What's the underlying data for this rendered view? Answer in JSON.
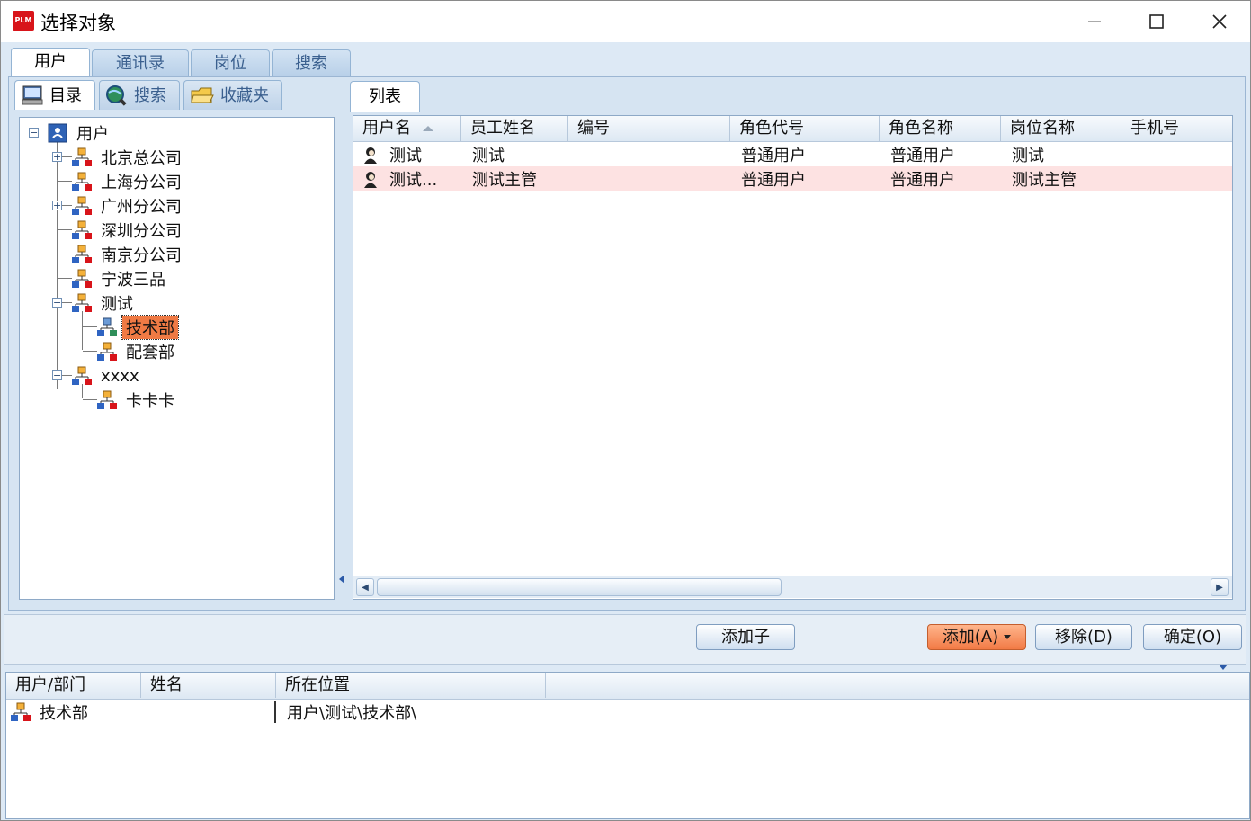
{
  "window": {
    "title": "选择对象",
    "logo_text": "PLM",
    "controls": [
      "minimize",
      "maximize",
      "close"
    ]
  },
  "main_tabs": [
    {
      "label": "用户",
      "active": true
    },
    {
      "label": "通讯录",
      "active": false
    },
    {
      "label": "岗位",
      "active": false
    },
    {
      "label": "搜索",
      "active": false
    }
  ],
  "sub_tabs": [
    {
      "label": "目录",
      "icon": "computer-icon",
      "active": true
    },
    {
      "label": "搜索",
      "icon": "globe-search-icon",
      "active": false
    },
    {
      "label": "收藏夹",
      "icon": "folder-favorites-icon",
      "active": false
    }
  ],
  "tree": {
    "root": "用户",
    "nodes": [
      {
        "label": "北京总公司",
        "expander": "+"
      },
      {
        "label": "上海分公司",
        "expander": ""
      },
      {
        "label": "广州分公司",
        "expander": "+"
      },
      {
        "label": "深圳分公司",
        "expander": ""
      },
      {
        "label": "南京分公司",
        "expander": ""
      },
      {
        "label": "宁波三品",
        "expander": ""
      },
      {
        "label": "测试",
        "expander": "−"
      },
      {
        "label": "技术部",
        "expander": "",
        "selected": true
      },
      {
        "label": "配套部",
        "expander": ""
      },
      {
        "label": "xxxx",
        "expander": "−"
      },
      {
        "label": "卡卡卡",
        "expander": ""
      }
    ]
  },
  "list": {
    "tab_label": "列表",
    "columns": [
      "用户名",
      "员工姓名",
      "编号",
      "角色代号",
      "角色名称",
      "岗位名称",
      "手机号"
    ],
    "rows": [
      [
        "测试",
        "测试",
        "",
        "普通用户",
        "普通用户",
        "测试",
        ""
      ],
      [
        "测试...",
        "测试主管",
        "",
        "普通用户",
        "普通用户",
        "测试主管",
        ""
      ]
    ]
  },
  "actions": {
    "add_child": "添加子",
    "add": "添加(A)",
    "remove": "移除(D)",
    "ok": "确定(O)"
  },
  "selection": {
    "columns": [
      "用户/部门",
      "姓名",
      "所在位置"
    ],
    "rows": [
      {
        "type": "department",
        "name": "技术部",
        "person": "",
        "location": "用户\\测试\\技术部\\"
      }
    ]
  },
  "colors": {
    "selected_row": "#fde2e2",
    "accent": "#f27a45"
  }
}
